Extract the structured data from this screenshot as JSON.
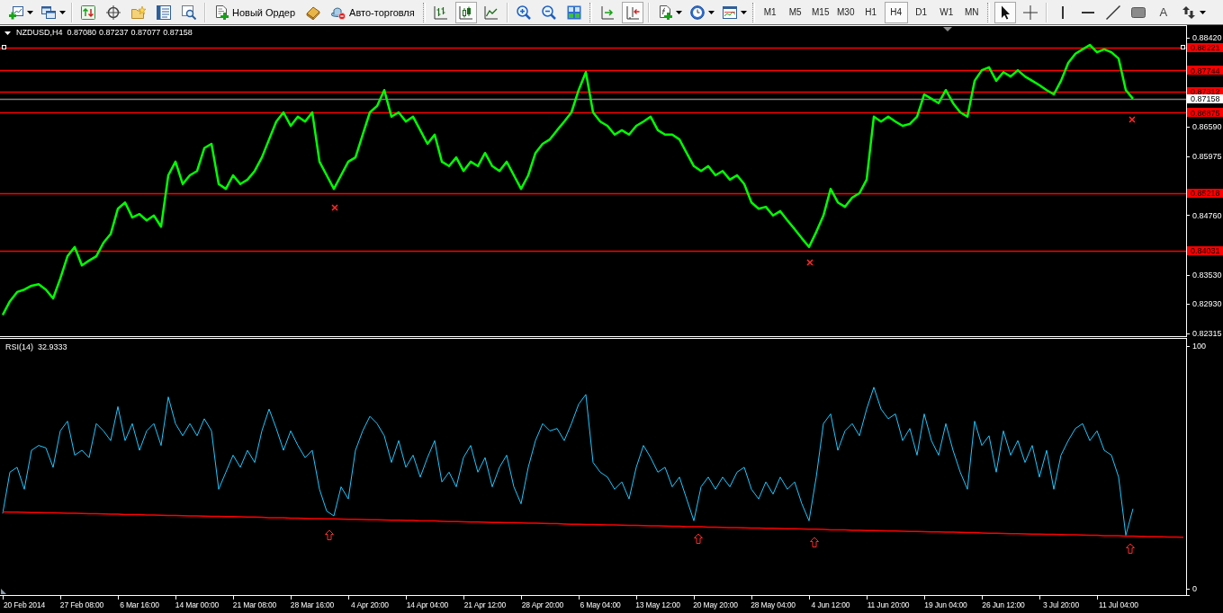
{
  "toolbar": {
    "order_button": {
      "label": "Новый Ордер"
    },
    "autotrading_button": {
      "label": "Авто-торговля"
    },
    "chart_types": [
      {
        "selected": false
      },
      {
        "selected": true
      },
      {
        "selected": false
      }
    ],
    "autoscroll": {
      "on": false
    },
    "chart_shift": {
      "on": true
    },
    "timeframes": [
      {
        "label": "M1",
        "selected": false
      },
      {
        "label": "M5",
        "selected": false
      },
      {
        "label": "M15",
        "selected": false
      },
      {
        "label": "M30",
        "selected": false
      },
      {
        "label": "H1",
        "selected": false
      },
      {
        "label": "H4",
        "selected": true
      },
      {
        "label": "D1",
        "selected": false
      },
      {
        "label": "W1",
        "selected": false
      },
      {
        "label": "MN",
        "selected": false
      }
    ],
    "pointer_tools": [
      {
        "selected": true
      },
      {
        "selected": false
      }
    ],
    "drawing_tools": [
      {
        "kind": "icon",
        "selected": false
      },
      {
        "kind": "icon",
        "selected": false
      },
      {
        "kind": "icon",
        "selected": false
      },
      {
        "kind": "icon",
        "selected": false
      },
      {
        "kind": "glyph",
        "glyph": "A",
        "selected": false
      },
      {
        "kind": "menu",
        "selected": false
      }
    ]
  },
  "chart": {
    "ohlc": [
      "0.87080",
      "0.87237",
      "0.87077",
      "0.87158"
    ],
    "chart_data": {
      "type": "line",
      "title": "NZDUSD,H4",
      "categories": [
        null,
        null,
        null,
        null,
        null,
        null,
        null,
        null,
        null,
        null,
        null,
        null,
        null,
        null,
        null,
        null,
        null,
        null,
        null,
        null,
        null,
        null,
        null,
        null,
        null,
        null,
        null,
        null,
        null,
        null,
        null,
        null,
        null,
        null,
        null,
        null,
        null,
        null,
        null,
        null,
        null,
        null,
        null,
        null,
        null,
        null,
        null,
        null,
        null,
        null,
        null,
        null,
        null,
        null,
        null,
        null,
        null,
        null,
        null,
        null,
        null,
        null,
        null,
        null,
        null,
        null,
        null,
        null,
        null,
        null,
        null,
        null,
        null,
        null,
        null,
        null,
        null,
        null,
        null,
        null,
        null,
        null,
        null,
        null,
        null,
        null,
        null,
        null,
        null,
        null,
        null,
        null,
        null,
        null,
        null,
        null,
        null,
        null,
        null,
        null,
        null,
        null,
        null,
        null,
        null,
        null,
        null,
        null,
        null,
        null,
        null,
        null,
        null,
        null,
        null,
        null,
        null,
        null,
        null,
        null,
        null,
        null,
        null,
        null,
        null,
        null,
        null,
        null,
        null,
        null,
        null,
        null,
        null,
        null,
        null,
        null,
        null,
        null,
        null,
        null,
        null,
        null,
        null,
        null,
        null,
        null,
        null,
        null,
        null,
        null,
        null,
        null,
        null,
        null,
        null,
        null,
        null,
        null,
        null,
        null,
        null,
        null,
        null,
        null,
        null
      ],
      "ylim": [
        0.8226,
        0.8866
      ],
      "yticks": [
        {
          "value": 0.8842,
          "label": "0.88420"
        },
        {
          "value": 0.8659,
          "label": "0.86590"
        },
        {
          "value": 0.85975,
          "label": "0.85975"
        },
        {
          "value": 0.8476,
          "label": "0.84760"
        },
        {
          "value": 0.8353,
          "label": "0.83530"
        },
        {
          "value": 0.8293,
          "label": "0.82930"
        },
        {
          "value": 0.82315,
          "label": "0.82315"
        }
      ],
      "series": [
        {
          "color": "#00ff00",
          "values": [
            0.827,
            0.8298,
            0.8317,
            0.8322,
            0.833,
            0.8333,
            0.8322,
            0.8304,
            0.8345,
            0.8391,
            0.841,
            0.8372,
            0.8382,
            0.8391,
            0.8419,
            0.8437,
            0.8489,
            0.8502,
            0.8471,
            0.8478,
            0.8465,
            0.8475,
            0.8452,
            0.8558,
            0.8586,
            0.854,
            0.8558,
            0.8567,
            0.8614,
            0.8623,
            0.854,
            0.853,
            0.8558,
            0.854,
            0.8549,
            0.8567,
            0.8595,
            0.8632,
            0.8669,
            0.8688,
            0.866,
            0.8679,
            0.8669,
            0.8688,
            0.8586,
            0.8558,
            0.853,
            0.8558,
            0.8586,
            0.8595,
            0.8642,
            0.8688,
            0.8701,
            0.8734,
            0.8679,
            0.8688,
            0.8669,
            0.8679,
            0.8651,
            0.8623,
            0.8642,
            0.8586,
            0.8577,
            0.8595,
            0.8567,
            0.8586,
            0.8577,
            0.8604,
            0.8577,
            0.8567,
            0.8586,
            0.8558,
            0.853,
            0.8558,
            0.8604,
            0.8623,
            0.8632,
            0.8651,
            0.8669,
            0.8688,
            0.8734,
            0.8771,
            0.8688,
            0.8669,
            0.866,
            0.8642,
            0.8651,
            0.8642,
            0.866,
            0.8669,
            0.8679,
            0.8651,
            0.8642,
            0.8642,
            0.8632,
            0.8604,
            0.8577,
            0.8567,
            0.8577,
            0.8558,
            0.8567,
            0.8549,
            0.8558,
            0.854,
            0.8502,
            0.8489,
            0.8493,
            0.8475,
            0.8484,
            0.8465,
            0.8447,
            0.8428,
            0.841,
            0.8441,
            0.8475,
            0.853,
            0.8502,
            0.8493,
            0.8512,
            0.8521,
            0.8549,
            0.8679,
            0.8669,
            0.8679,
            0.8669,
            0.866,
            0.8664,
            0.8679,
            0.8725,
            0.8716,
            0.8707,
            0.8734,
            0.8707,
            0.8688,
            0.8679,
            0.8753,
            0.8775,
            0.8781,
            0.8753,
            0.8771,
            0.8762,
            0.8775,
            0.8762,
            0.8753,
            0.8744,
            0.8734,
            0.8725,
            0.8753,
            0.879,
            0.8809,
            0.8818,
            0.8827,
            0.8812,
            0.8818,
            0.8812,
            0.8799,
            0.8734,
            0.8716,
            null,
            null,
            null,
            null,
            null,
            null,
            null
          ]
        }
      ],
      "ref_lines": [
        {
          "axis": "y",
          "value": 0.88221,
          "label": "0.88221",
          "color": "#ff0000"
        },
        {
          "axis": "y",
          "value": 0.87744,
          "label": "0.87744",
          "color": "#ff0000"
        },
        {
          "axis": "y",
          "value": 0.87312,
          "label": "0.87312",
          "color": "#ff0000"
        },
        {
          "axis": "y",
          "value": 0.87158,
          "label": "0.87158",
          "color": "#808080"
        },
        {
          "axis": "y",
          "value": 0.86875,
          "label": "0.86875",
          "color": "#ff0000"
        },
        {
          "axis": "y",
          "value": 0.85218,
          "label": "0.85218",
          "color": "#ff0000"
        },
        {
          "axis": "y",
          "value": 0.84031,
          "label": "0.84031",
          "color": "#ff0000"
        }
      ]
    }
  },
  "indicator": {
    "value": "32.9333",
    "chart_data": {
      "type": "line",
      "title": "RSI(14)",
      "categories": [
        null,
        null,
        null,
        "20 Feb 2014",
        null,
        null,
        null,
        null,
        null,
        null,
        null,
        "27 Feb 08:00",
        null,
        null,
        null,
        null,
        null,
        null,
        null,
        "6 Mar 16:00",
        null,
        null,
        null,
        null,
        null,
        null,
        null,
        "14 Mar 00:00",
        null,
        null,
        null,
        null,
        null,
        null,
        null,
        "21 Mar 08:00",
        null,
        null,
        null,
        null,
        null,
        null,
        null,
        "28 Mar 16:00",
        null,
        null,
        null,
        null,
        null,
        null,
        null,
        "4 Apr 20:00",
        null,
        null,
        null,
        null,
        null,
        null,
        null,
        "14 Apr 04:00",
        null,
        null,
        null,
        null,
        null,
        null,
        null,
        "21 Apr 12:00",
        null,
        null,
        null,
        null,
        null,
        null,
        null,
        "28 Apr 20:00",
        null,
        null,
        null,
        null,
        null,
        null,
        null,
        "6 May 04:00",
        null,
        null,
        null,
        null,
        null,
        null,
        null,
        "13 May 12:00",
        null,
        null,
        null,
        null,
        null,
        null,
        null,
        "20 May 20:00",
        null,
        null,
        null,
        null,
        null,
        null,
        null,
        "28 May 04:00",
        null,
        null,
        null,
        null,
        null,
        null,
        null,
        "4 Jun 12:00",
        null,
        null,
        null,
        null,
        null,
        null,
        null,
        "11 Jun 20:00",
        null,
        null,
        null,
        null,
        null,
        null,
        null,
        "19 Jun 04:00",
        null,
        null,
        null,
        null,
        null,
        null,
        null,
        "26 Jun 12:00",
        null,
        null,
        null,
        null,
        null,
        null,
        null,
        "3 Jul 20:00",
        null,
        null,
        null,
        null,
        null,
        null,
        null,
        "11 Jul 04:00",
        null,
        null,
        null,
        null,
        null,
        null,
        null,
        null,
        null
      ],
      "ylim": [
        -2.77,
        103.1
      ],
      "yticks": [
        {
          "value": 100,
          "label": "100"
        },
        {
          "value": 0,
          "label": "0"
        }
      ],
      "series": [
        {
          "color": "#1ec8ff",
          "values": [
            31,
            48,
            50,
            41,
            57,
            59,
            58,
            50,
            65,
            69,
            55,
            57,
            54,
            68,
            65,
            61,
            75,
            61,
            68,
            57,
            65,
            68,
            59,
            79,
            68,
            63,
            68,
            63,
            70,
            65,
            41,
            48,
            55,
            50,
            57,
            52,
            65,
            74,
            66,
            57,
            65,
            59,
            54,
            57,
            41,
            32,
            30,
            42,
            37,
            57,
            65,
            71,
            68,
            63,
            52,
            61,
            50,
            55,
            46,
            54,
            61,
            44,
            48,
            42,
            54,
            59,
            48,
            54,
            42,
            50,
            55,
            42,
            35,
            50,
            61,
            68,
            65,
            66,
            61,
            68,
            76,
            80,
            52,
            48,
            46,
            41,
            44,
            37,
            50,
            59,
            54,
            48,
            50,
            42,
            46,
            37,
            28,
            42,
            46,
            41,
            46,
            42,
            48,
            50,
            41,
            37,
            44,
            39,
            46,
            41,
            44,
            35,
            28,
            46,
            68,
            72,
            57,
            65,
            68,
            63,
            74,
            83,
            74,
            70,
            72,
            61,
            66,
            55,
            72,
            61,
            55,
            68,
            57,
            48,
            41,
            69,
            59,
            63,
            48,
            65,
            55,
            61,
            52,
            59,
            46,
            57,
            41,
            55,
            61,
            66,
            68,
            61,
            65,
            57,
            55,
            46,
            22,
            33,
            null,
            null,
            null,
            null,
            null,
            null,
            null
          ]
        },
        {
          "color": "#ff0000",
          "values": [
            31.7,
            31.6,
            31.6,
            31.5,
            31.4,
            31.4,
            31.3,
            31.3,
            31.2,
            31.1,
            31.1,
            31.0,
            30.9,
            30.9,
            30.8,
            30.7,
            30.7,
            30.6,
            30.5,
            30.5,
            30.4,
            30.4,
            30.3,
            30.2,
            30.2,
            30.1,
            30.0,
            30.0,
            29.9,
            29.8,
            29.8,
            29.7,
            29.7,
            29.6,
            29.5,
            29.5,
            29.4,
            29.3,
            29.3,
            29.2,
            29.1,
            29.1,
            29.0,
            28.9,
            28.9,
            28.8,
            28.8,
            28.7,
            28.6,
            28.6,
            28.5,
            28.4,
            28.4,
            28.3,
            28.2,
            28.2,
            28.1,
            28.1,
            28.0,
            27.9,
            27.9,
            27.8,
            27.7,
            27.7,
            27.6,
            27.5,
            27.5,
            27.4,
            27.3,
            27.3,
            27.2,
            27.2,
            27.1,
            27.0,
            27.0,
            26.9,
            26.8,
            26.8,
            26.7,
            26.6,
            26.6,
            26.5,
            26.5,
            26.4,
            26.3,
            26.3,
            26.2,
            26.1,
            26.1,
            26.0,
            25.9,
            25.9,
            25.8,
            25.7,
            25.7,
            25.6,
            25.6,
            25.5,
            25.4,
            25.4,
            25.3,
            25.2,
            25.2,
            25.1,
            25.0,
            25.0,
            24.9,
            24.9,
            24.8,
            24.7,
            24.7,
            24.6,
            24.5,
            24.5,
            24.4,
            24.3,
            24.3,
            24.2,
            24.1,
            24.1,
            24.0,
            24.0,
            23.9,
            23.8,
            23.8,
            23.7,
            23.6,
            23.6,
            23.5,
            23.4,
            23.4,
            23.3,
            23.3,
            23.2,
            23.1,
            23.1,
            23.0,
            22.9,
            22.9,
            22.8,
            22.7,
            22.7,
            22.6,
            22.5,
            22.5,
            22.4,
            22.4,
            22.3,
            22.2,
            22.2,
            22.1,
            22.0,
            22.0,
            21.9,
            21.8,
            21.8,
            21.7,
            21.7,
            21.6,
            21.5,
            21.5,
            21.4,
            21.3,
            21.3,
            21.2
          ]
        }
      ]
    }
  }
}
